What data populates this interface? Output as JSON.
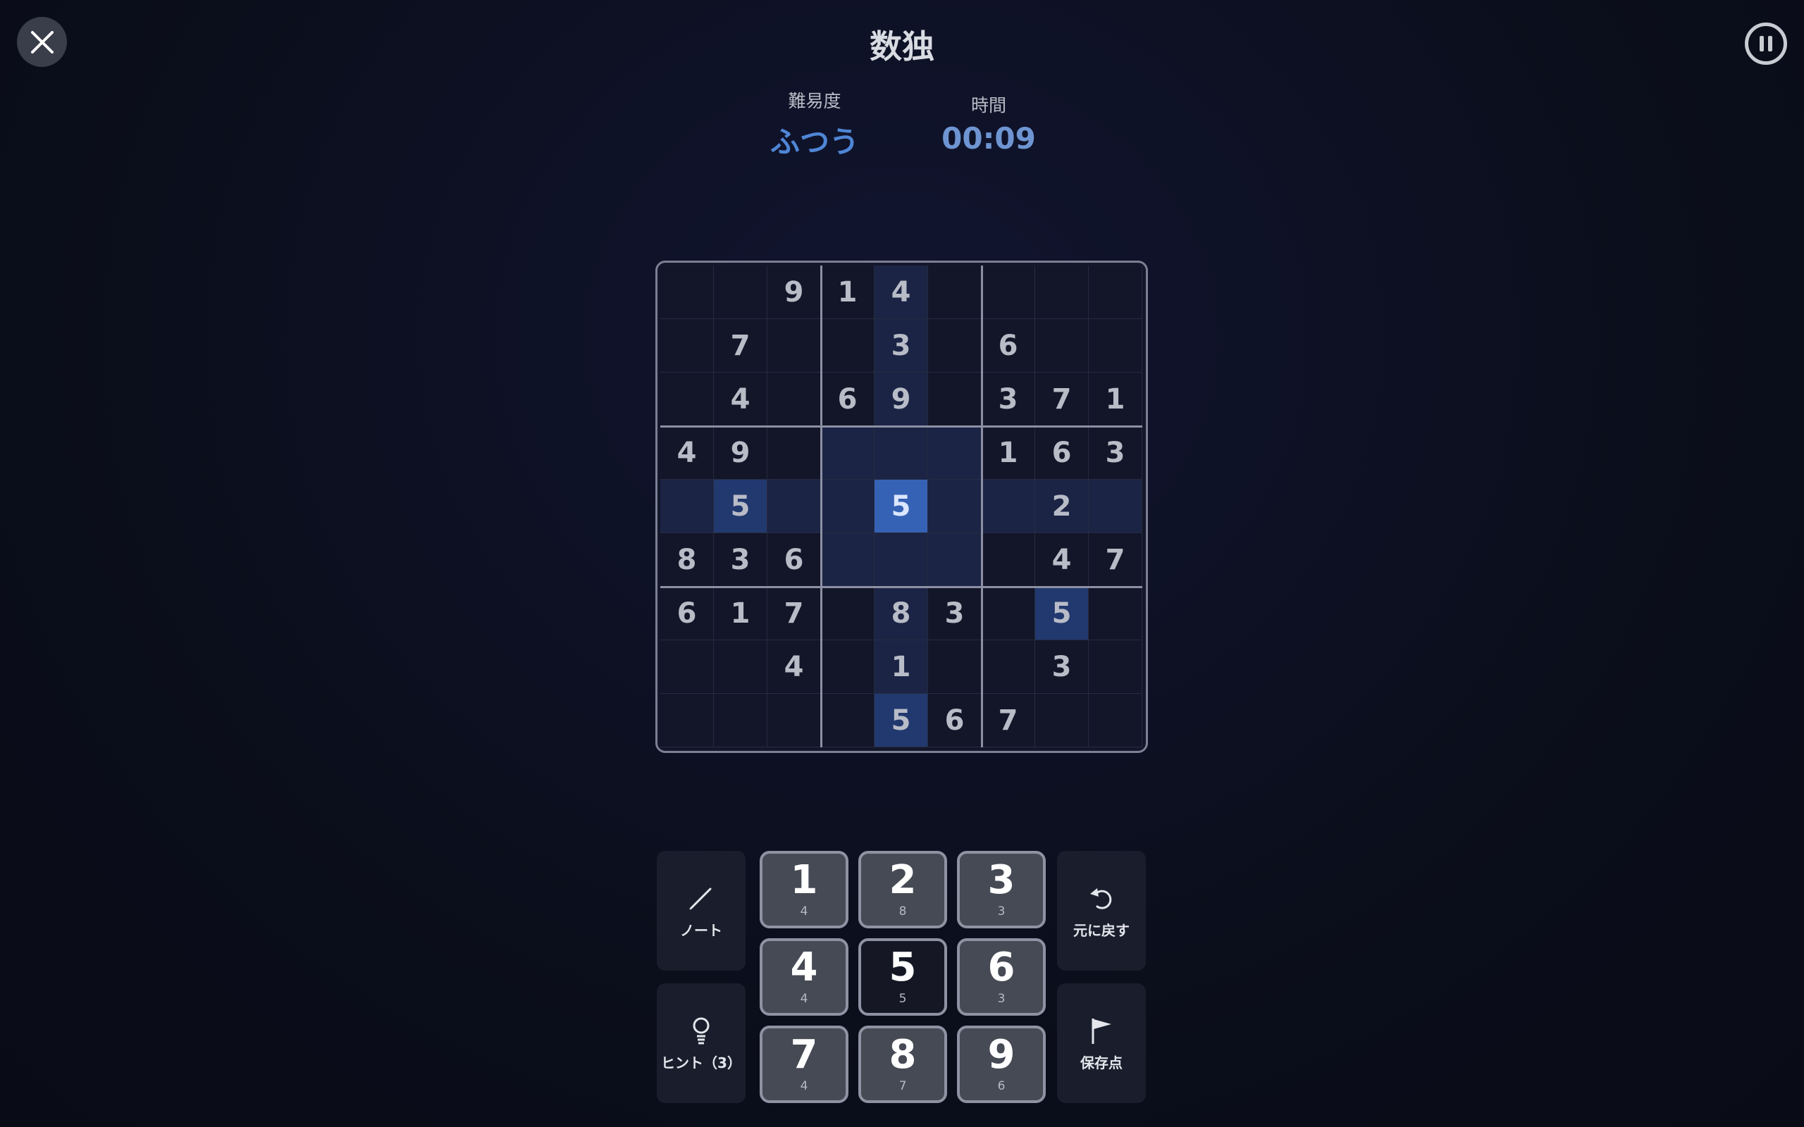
{
  "header": {
    "title": "数独",
    "difficulty_label": "難易度",
    "difficulty_value": "ふつう",
    "time_label": "時間",
    "time_value": "00:09"
  },
  "board": {
    "selected": [
      4,
      4
    ],
    "selected_value": "5",
    "rows": [
      [
        "",
        "",
        "9",
        "1",
        "4",
        "",
        "",
        "",
        ""
      ],
      [
        "",
        "7",
        "",
        "",
        "3",
        "",
        "6",
        "",
        ""
      ],
      [
        "",
        "4",
        "",
        "6",
        "9",
        "",
        "3",
        "7",
        "1"
      ],
      [
        "4",
        "9",
        "",
        "",
        "",
        "",
        "1",
        "6",
        "3"
      ],
      [
        "",
        "5",
        "",
        "",
        "5",
        "",
        "",
        "2",
        ""
      ],
      [
        "8",
        "3",
        "6",
        "",
        "",
        "",
        "",
        "4",
        "7"
      ],
      [
        "6",
        "1",
        "7",
        "",
        "8",
        "3",
        "",
        "5",
        ""
      ],
      [
        "",
        "",
        "4",
        "",
        "1",
        "",
        "",
        "3",
        ""
      ],
      [
        "",
        "",
        "",
        "",
        "5",
        "6",
        "7",
        "",
        ""
      ]
    ]
  },
  "controls": {
    "note_label": "ノート",
    "hint_label": "ヒント（3）",
    "undo_label": "元に戻す",
    "savepoint_label": "保存点"
  },
  "numpad": [
    {
      "digit": "1",
      "count": "4"
    },
    {
      "digit": "2",
      "count": "8"
    },
    {
      "digit": "3",
      "count": "3"
    },
    {
      "digit": "4",
      "count": "4"
    },
    {
      "digit": "5",
      "count": "5"
    },
    {
      "digit": "6",
      "count": "3"
    },
    {
      "digit": "7",
      "count": "4"
    },
    {
      "digit": "8",
      "count": "7"
    },
    {
      "digit": "9",
      "count": "6"
    }
  ],
  "colors": {
    "background": "#0b0e1b",
    "accent": "#4f86d6",
    "selected_cell": "#3562b4",
    "highlight_cell": "#1b2445"
  }
}
